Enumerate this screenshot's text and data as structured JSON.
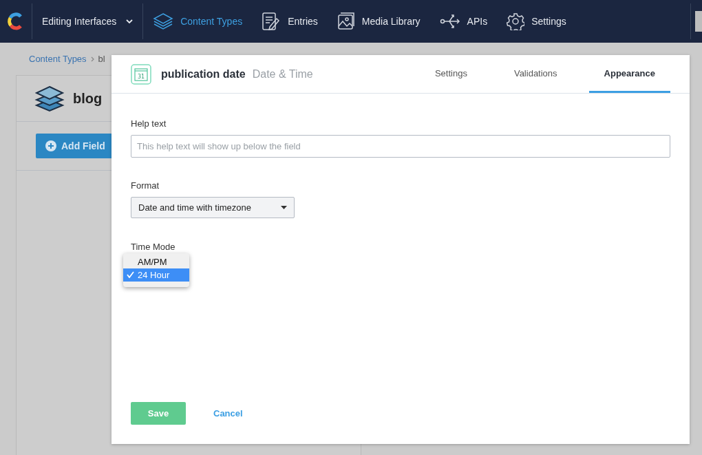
{
  "nav": {
    "workspace": "Editing Interfaces",
    "items": [
      {
        "label": "Content Types",
        "kind": "layers",
        "selected": true
      },
      {
        "label": "Entries",
        "kind": "entries",
        "selected": false
      },
      {
        "label": "Media Library",
        "kind": "media",
        "selected": false
      },
      {
        "label": "APIs",
        "kind": "apis",
        "selected": false
      },
      {
        "label": "Settings",
        "kind": "gear",
        "selected": false
      }
    ]
  },
  "breadcrumb": [
    "Content Types",
    "bl"
  ],
  "content_type": {
    "title": "blog",
    "add_field_button": "Add Field"
  },
  "modal": {
    "field_name": "publication date",
    "field_type": "Date & Time",
    "calendar_day": "31",
    "tabs": [
      {
        "label": "Settings",
        "selected": false
      },
      {
        "label": "Validations",
        "selected": false
      },
      {
        "label": "Appearance",
        "selected": true
      }
    ],
    "help_text": {
      "label": "Help text",
      "placeholder": "This help text will show up below the field"
    },
    "format": {
      "label": "Format",
      "value": "Date and time with timezone"
    },
    "time_mode": {
      "label": "Time Mode",
      "options": [
        {
          "label": "AM/PM",
          "selected": false
        },
        {
          "label": "24 Hour",
          "selected": true
        }
      ]
    },
    "save_button": "Save",
    "cancel_link": "Cancel"
  }
}
